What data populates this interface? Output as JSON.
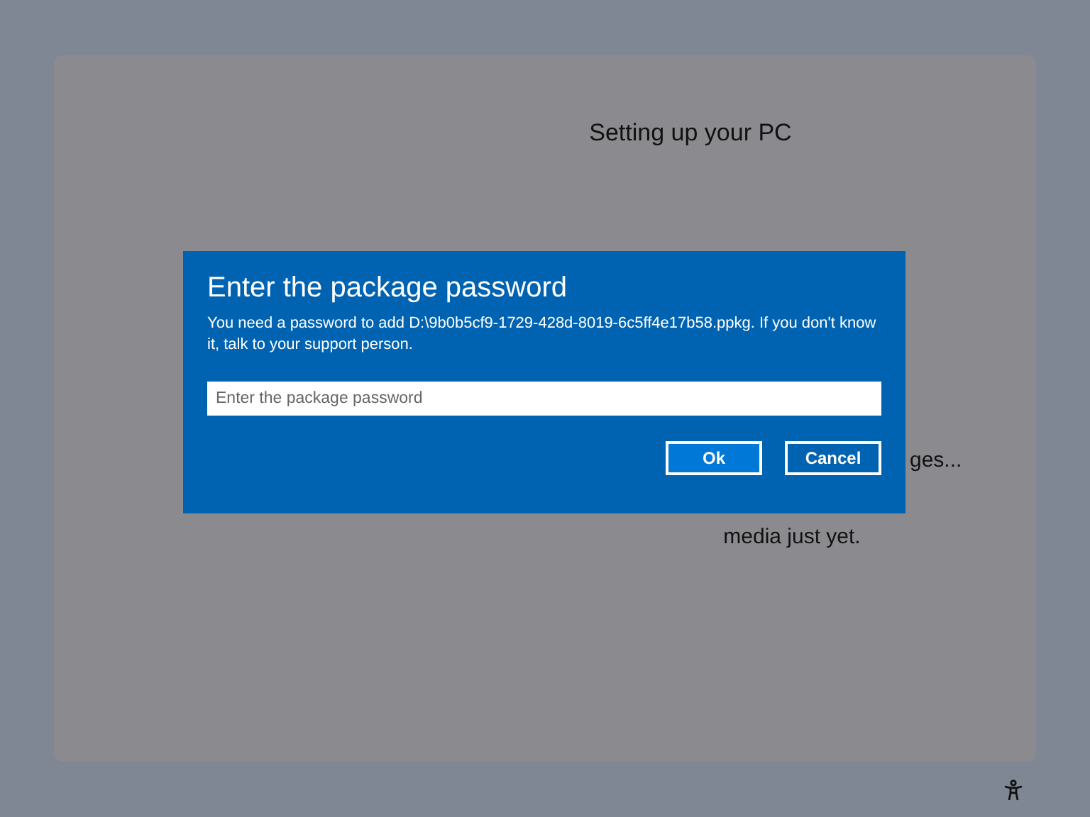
{
  "background_window": {
    "title": "Setting up your PC",
    "status_fragment": "ges...",
    "status_last_line": "media just yet."
  },
  "dialog": {
    "title": "Enter the package password",
    "message": "You need a password to add D:\\9b0b5cf9-1729-428d-8019-6c5ff4e17b58.ppkg. If you don't know it, talk to your support person.",
    "password_field": {
      "placeholder": "Enter the package password"
    },
    "buttons": [
      {
        "label": "Ok",
        "kind": "primary"
      },
      {
        "label": "Cancel",
        "kind": "secondary"
      }
    ]
  }
}
